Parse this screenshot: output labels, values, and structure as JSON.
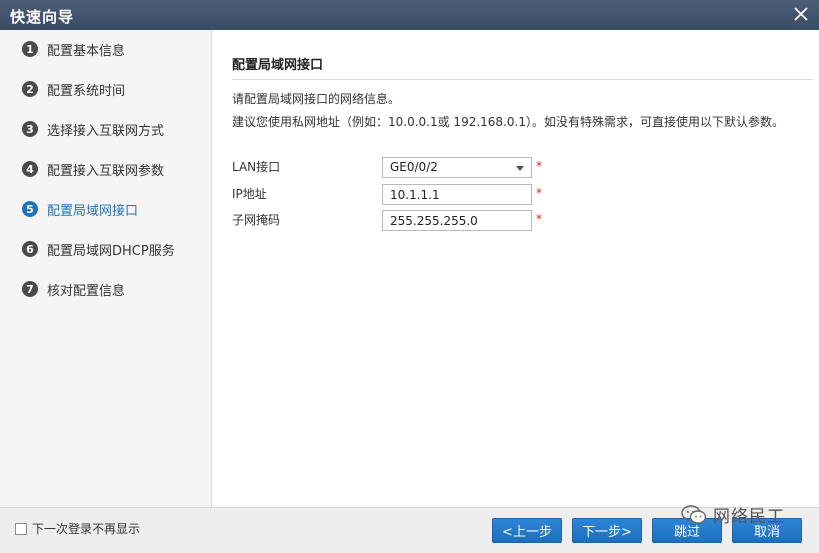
{
  "window": {
    "title": "快速向导",
    "close_icon": "close-icon"
  },
  "sidebar": {
    "steps": [
      {
        "num": "1",
        "label": "配置基本信息",
        "active": false
      },
      {
        "num": "2",
        "label": "配置系统时间",
        "active": false
      },
      {
        "num": "3",
        "label": "选择接入互联网方式",
        "active": false
      },
      {
        "num": "4",
        "label": "配置接入互联网参数",
        "active": false
      },
      {
        "num": "5",
        "label": "配置局域网接口",
        "active": true
      },
      {
        "num": "6",
        "label": "配置局域网DHCP服务",
        "active": false
      },
      {
        "num": "7",
        "label": "核对配置信息",
        "active": false
      }
    ]
  },
  "main": {
    "section_title": "配置局域网接口",
    "info_line1": "请配置局域网接口的网络信息。",
    "info_line2": "建议您使用私网地址（例如：10.0.0.1或 192.168.0.1）。如没有特殊需求，可直接使用以下默认参数。",
    "form": {
      "lan_label": "LAN接口",
      "lan_value": "GE0/0/2",
      "ip_label": "IP地址",
      "ip_value": "10.1.1.1",
      "mask_label": "子网掩码",
      "mask_value": "255.255.255.0",
      "required_mark": "*"
    }
  },
  "footer": {
    "checkbox_label": "下一次登录不再显示",
    "prev_label": "<上一步",
    "next_label": "下一步>",
    "skip_label": "跳过",
    "cancel_label": "取消"
  },
  "watermark": {
    "text": "网络民工",
    "icon": "wechat-icon"
  },
  "colors": {
    "titlebar": "#3f5069",
    "accent": "#1e73be",
    "button": "#2576c8",
    "required": "#e02020"
  }
}
